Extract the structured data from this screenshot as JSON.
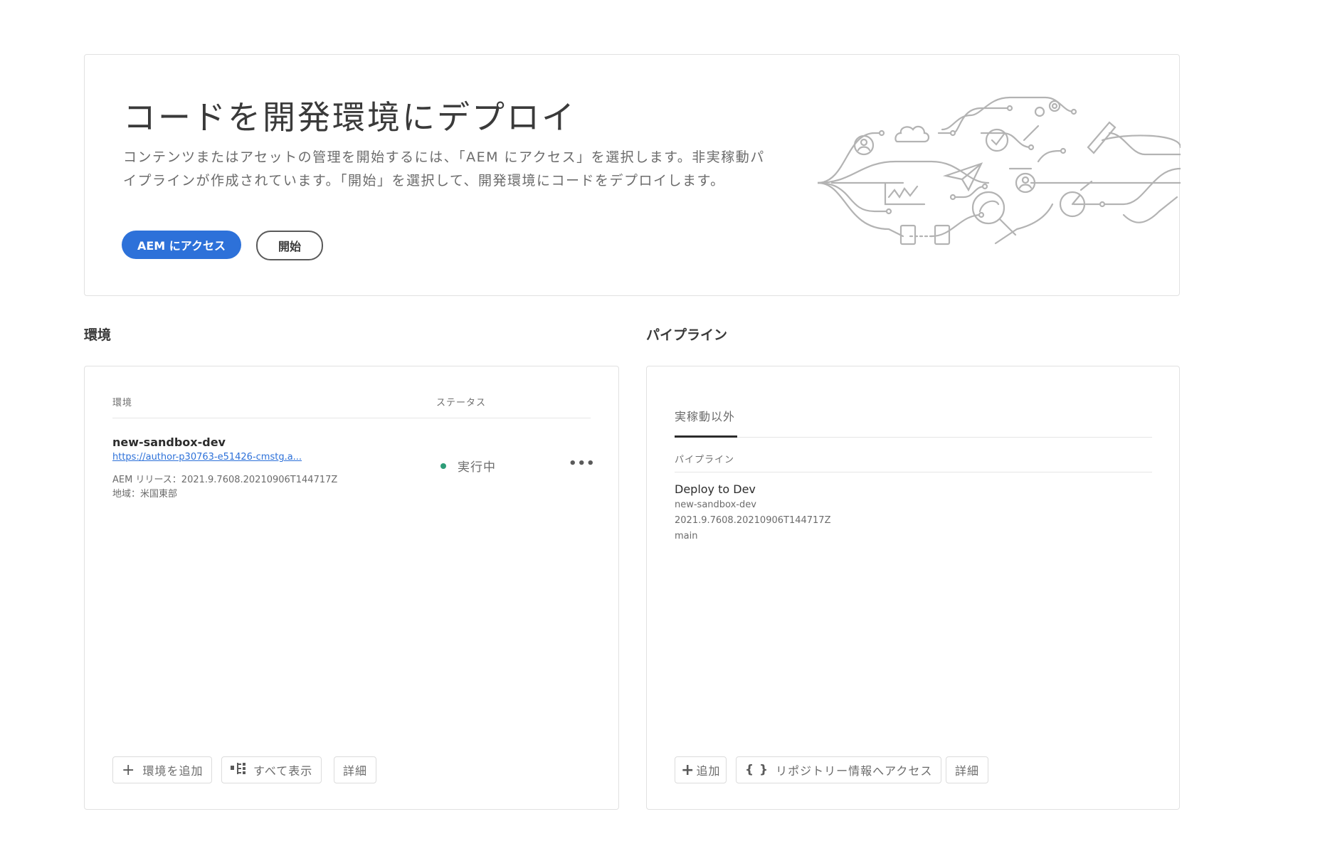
{
  "hero": {
    "title": "コードを開発環境にデプロイ",
    "description": "コンテンツまたはアセットの管理を開始するには、「AEM にアクセス」を選択します。非実稼動パイプラインが作成されています。「開始」を選択して、開発環境にコードをデプロイします。",
    "primary_button": "AEM にアクセス",
    "secondary_button": "開始",
    "accent_color": "#2d71d9"
  },
  "environments": {
    "heading": "環境",
    "columns": {
      "env": "環境",
      "status": "ステータス"
    },
    "items": [
      {
        "name": "new-sandbox-dev",
        "url": "https://author-p30763-e51426-cmstg.a...",
        "release": "AEM リリース：2021.9.7608.20210906T144717Z",
        "region": "地域：米国東部",
        "status": "実行中",
        "status_color": "#2d9d78",
        "more": "•••"
      }
    ],
    "actions": {
      "add": "環境を追加",
      "view_all": "すべて表示",
      "details": "詳細"
    }
  },
  "pipelines": {
    "heading": "パイプライン",
    "tab": "実稼動以外",
    "column": "パイプライン",
    "items": [
      {
        "name": "Deploy to Dev",
        "environment": "new-sandbox-dev",
        "version": "2021.9.7608.20210906T144717Z",
        "branch": "main"
      }
    ],
    "actions": {
      "add": "追加",
      "repo": "リポジトリー情報へアクセス",
      "details": "詳細"
    }
  }
}
